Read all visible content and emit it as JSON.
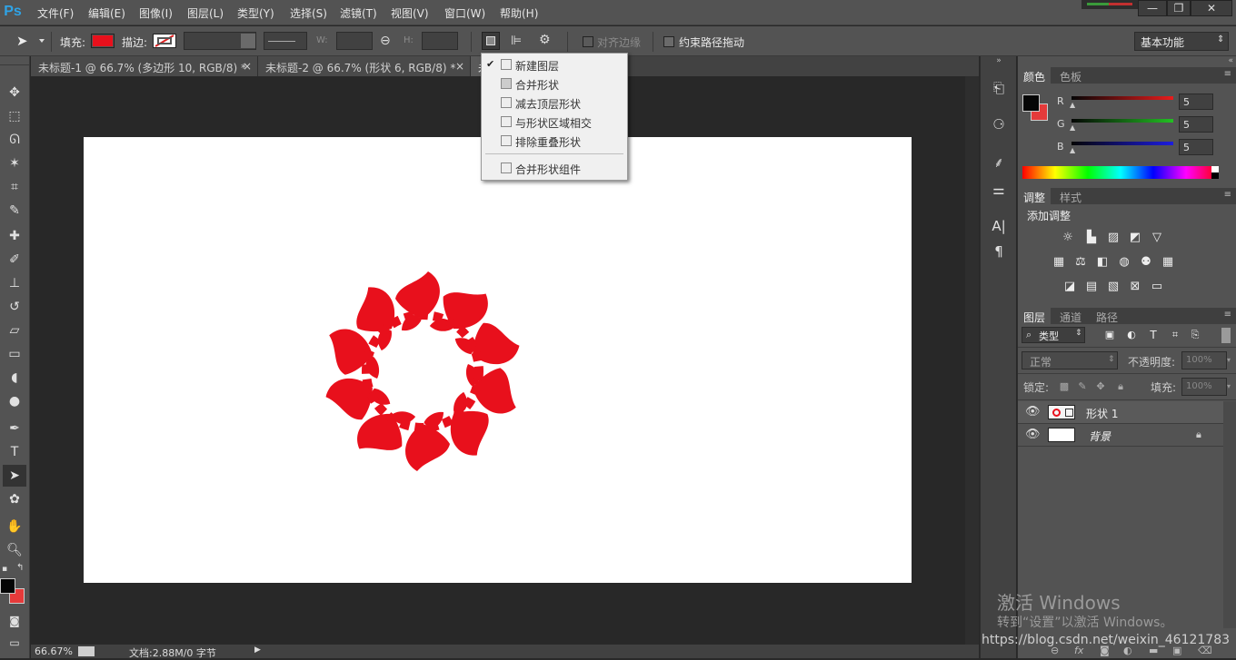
{
  "app": {
    "logo": "Ps"
  },
  "menu": [
    "文件(F)",
    "编辑(E)",
    "图像(I)",
    "图层(L)",
    "类型(Y)",
    "选择(S)",
    "滤镜(T)",
    "视图(V)",
    "窗口(W)",
    "帮助(H)"
  ],
  "window_controls": {
    "minimize": "—",
    "restore": "❐",
    "close": "✕"
  },
  "options": {
    "fill_label": "填充:",
    "stroke_label": "描边:",
    "w_label": "W:",
    "h_label": "H:",
    "align_edges_label": "对齐边缘",
    "constrain_path_label": "约束路径拖动",
    "workspace": "基本功能",
    "fill_color": "#e8101c"
  },
  "tabs": [
    {
      "label": "未标题-1 @ 66.7% (多边形 10, RGB/8) *",
      "close": "×"
    },
    {
      "label": "未标题-2 @ 66.7% (形状 6, RGB/8) *",
      "close": "×"
    },
    {
      "label": "未",
      "close": ""
    }
  ],
  "path_ops_menu": {
    "checked_mark": "✔",
    "items": [
      "新建图层",
      "合并形状",
      "减去顶层形状",
      "与形状区域相交",
      "排除重叠形状"
    ],
    "merge_components": "合并形状组件"
  },
  "status": {
    "zoom": "66.67%",
    "doc": "文档:2.88M/0 字节"
  },
  "color_panel": {
    "tabs": [
      "颜色",
      "色板"
    ],
    "channels": [
      {
        "label": "R",
        "value": "5",
        "color": "#e81c1c"
      },
      {
        "label": "G",
        "value": "5",
        "color": "#22c022"
      },
      {
        "label": "B",
        "value": "5",
        "color": "#1c1ce0"
      }
    ]
  },
  "adjust_panel": {
    "tabs": [
      "调整",
      "样式"
    ],
    "title": "添加调整"
  },
  "layers_panel": {
    "tabs": [
      "图层",
      "通道",
      "路径"
    ],
    "filter_label": "类型",
    "blend_mode": "正常",
    "opacity_label": "不透明度:",
    "opacity_value": "100%",
    "lock_label": "锁定:",
    "fill_label": "填充:",
    "fill_value": "100%",
    "layers": [
      {
        "name": "形状 1"
      },
      {
        "name": "背景"
      }
    ]
  },
  "watermark": {
    "line1": "激活 Windows",
    "line2": "转到“设置”以激活 Windows。",
    "url": "https://blog.csdn.net/weixin_46121783"
  }
}
